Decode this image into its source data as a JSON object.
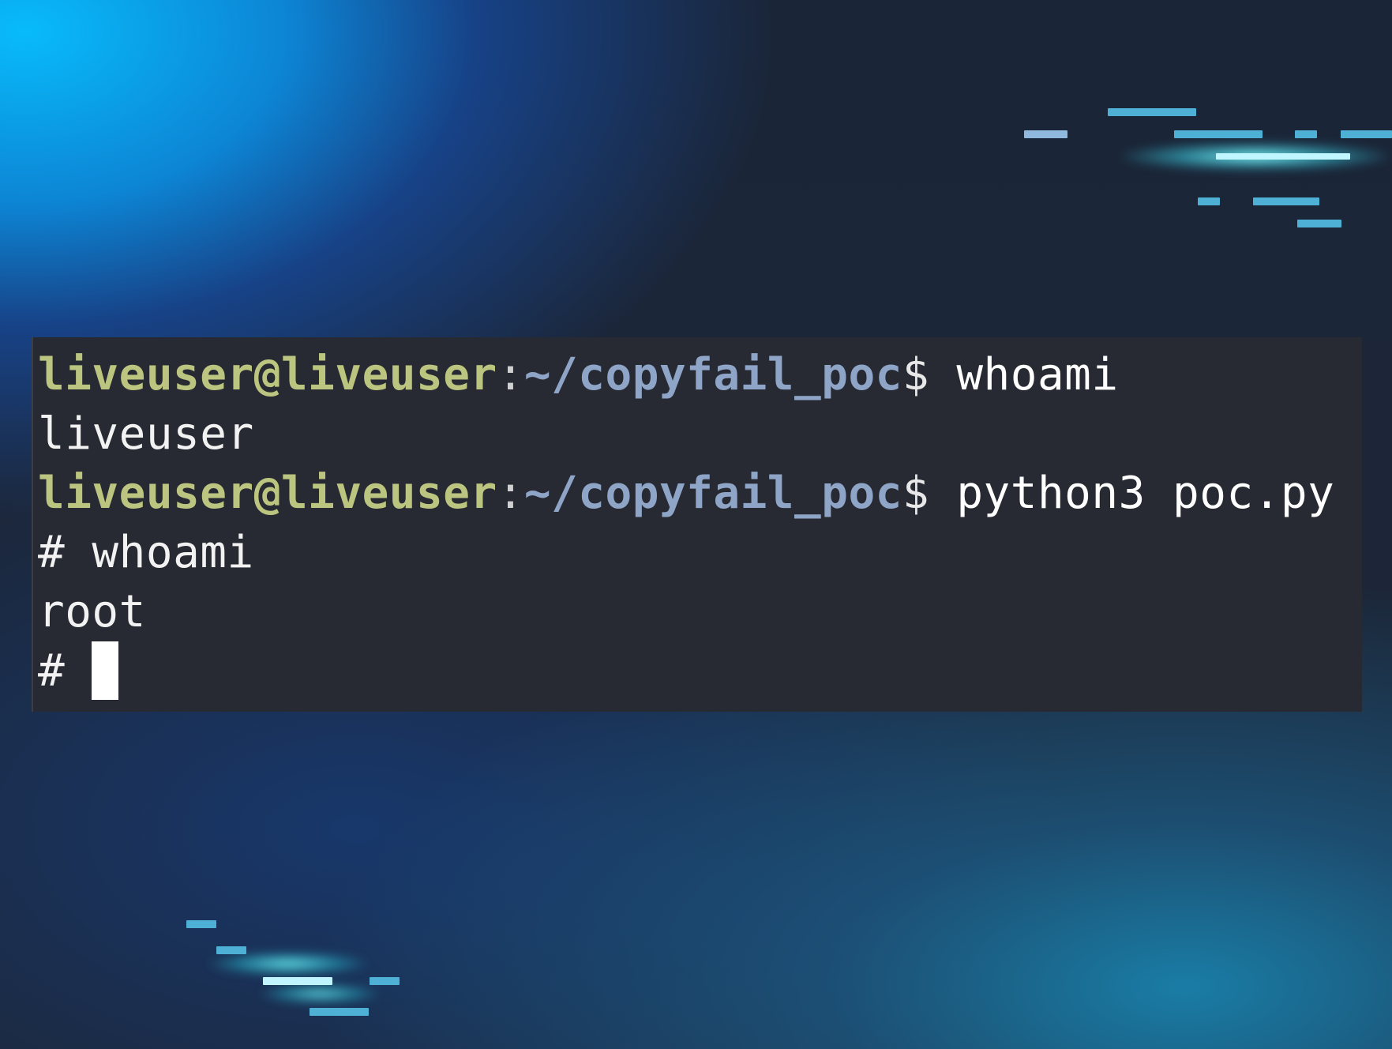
{
  "terminal": {
    "lines": [
      {
        "user": "liveuser@liveuser",
        "colon": ":",
        "path": "~/copyfail_poc",
        "prompt": "$",
        "command": " whoami"
      },
      {
        "output": "liveuser"
      },
      {
        "user": "liveuser@liveuser",
        "colon": ":",
        "path": "~/copyfail_poc",
        "prompt": "$",
        "command": " python3 poc.py"
      },
      {
        "output": "# whoami"
      },
      {
        "output": "root"
      },
      {
        "root_prompt": "# "
      }
    ]
  },
  "colors": {
    "terminal_bg": "#272a33",
    "user_host": "#bcc57f",
    "path": "#8fa5c7",
    "text": "#f2f2f2",
    "accent_cyan": "#4fb0d6"
  }
}
